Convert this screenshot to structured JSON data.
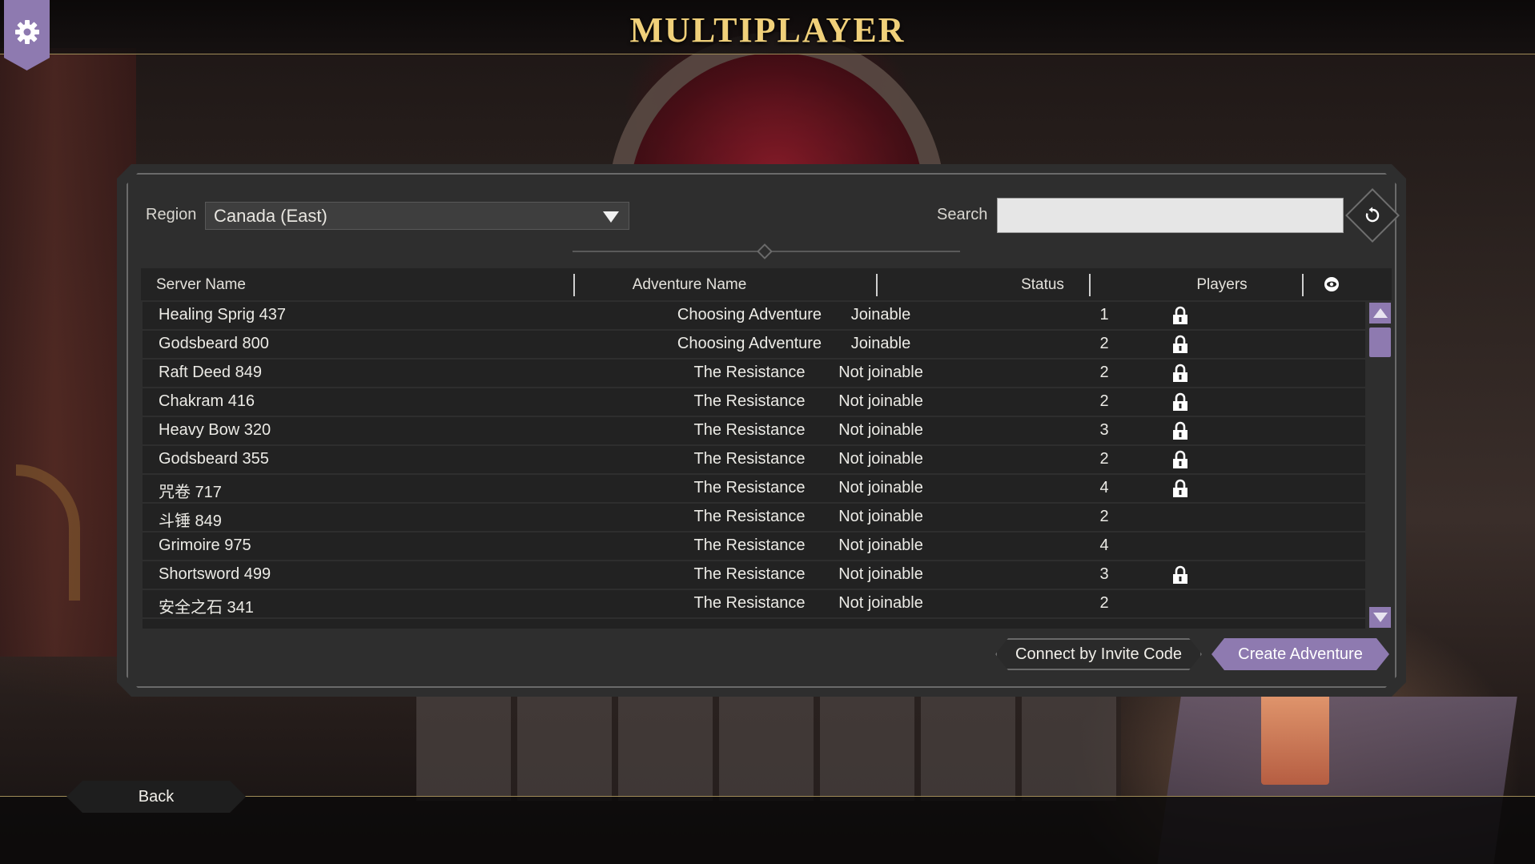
{
  "page": {
    "title": "MULTIPLAYER"
  },
  "filters": {
    "region_label": "Region",
    "region_value": "Canada (East)",
    "search_label": "Search",
    "search_value": ""
  },
  "table": {
    "columns": [
      "Server Name",
      "Adventure Name",
      "Status",
      "Players"
    ],
    "rows": [
      {
        "server": "Healing Sprig 437",
        "adventure": "Choosing Adventure",
        "status": "Joinable",
        "players": "1",
        "locked": true
      },
      {
        "server": "Godsbeard 800",
        "adventure": "Choosing Adventure",
        "status": "Joinable",
        "players": "2",
        "locked": true
      },
      {
        "server": "Raft Deed 849",
        "adventure": "The Resistance",
        "status": "Not joinable",
        "players": "2",
        "locked": true
      },
      {
        "server": "Chakram 416",
        "adventure": "The Resistance",
        "status": "Not joinable",
        "players": "2",
        "locked": true
      },
      {
        "server": "Heavy Bow 320",
        "adventure": "The Resistance",
        "status": "Not joinable",
        "players": "3",
        "locked": true
      },
      {
        "server": "Godsbeard 355",
        "adventure": "The Resistance",
        "status": "Not joinable",
        "players": "2",
        "locked": true
      },
      {
        "server": "咒卷 717",
        "adventure": "The Resistance",
        "status": "Not joinable",
        "players": "4",
        "locked": true
      },
      {
        "server": "斗锤 849",
        "adventure": "The Resistance",
        "status": "Not joinable",
        "players": "2",
        "locked": false
      },
      {
        "server": "Grimoire 975",
        "adventure": "The Resistance",
        "status": "Not joinable",
        "players": "4",
        "locked": false
      },
      {
        "server": "Shortsword 499",
        "adventure": "The Resistance",
        "status": "Not joinable",
        "players": "3",
        "locked": true
      },
      {
        "server": "安全之石 341",
        "adventure": "The Resistance",
        "status": "Not joinable",
        "players": "2",
        "locked": false
      }
    ]
  },
  "actions": {
    "invite_label": "Connect by Invite Code",
    "create_label": "Create Adventure",
    "back_label": "Back"
  },
  "icons": {
    "settings": "gear-icon",
    "refresh": "refresh-icon",
    "visibility": "eye-icon",
    "lock": "lock-icon",
    "region_caret": "chevron-down-icon"
  },
  "colors": {
    "accent_purple": "#8e7ab0",
    "title_gold": "#f0d07a",
    "panel_bg": "#2e2e2e",
    "row_bg": "#222222"
  }
}
